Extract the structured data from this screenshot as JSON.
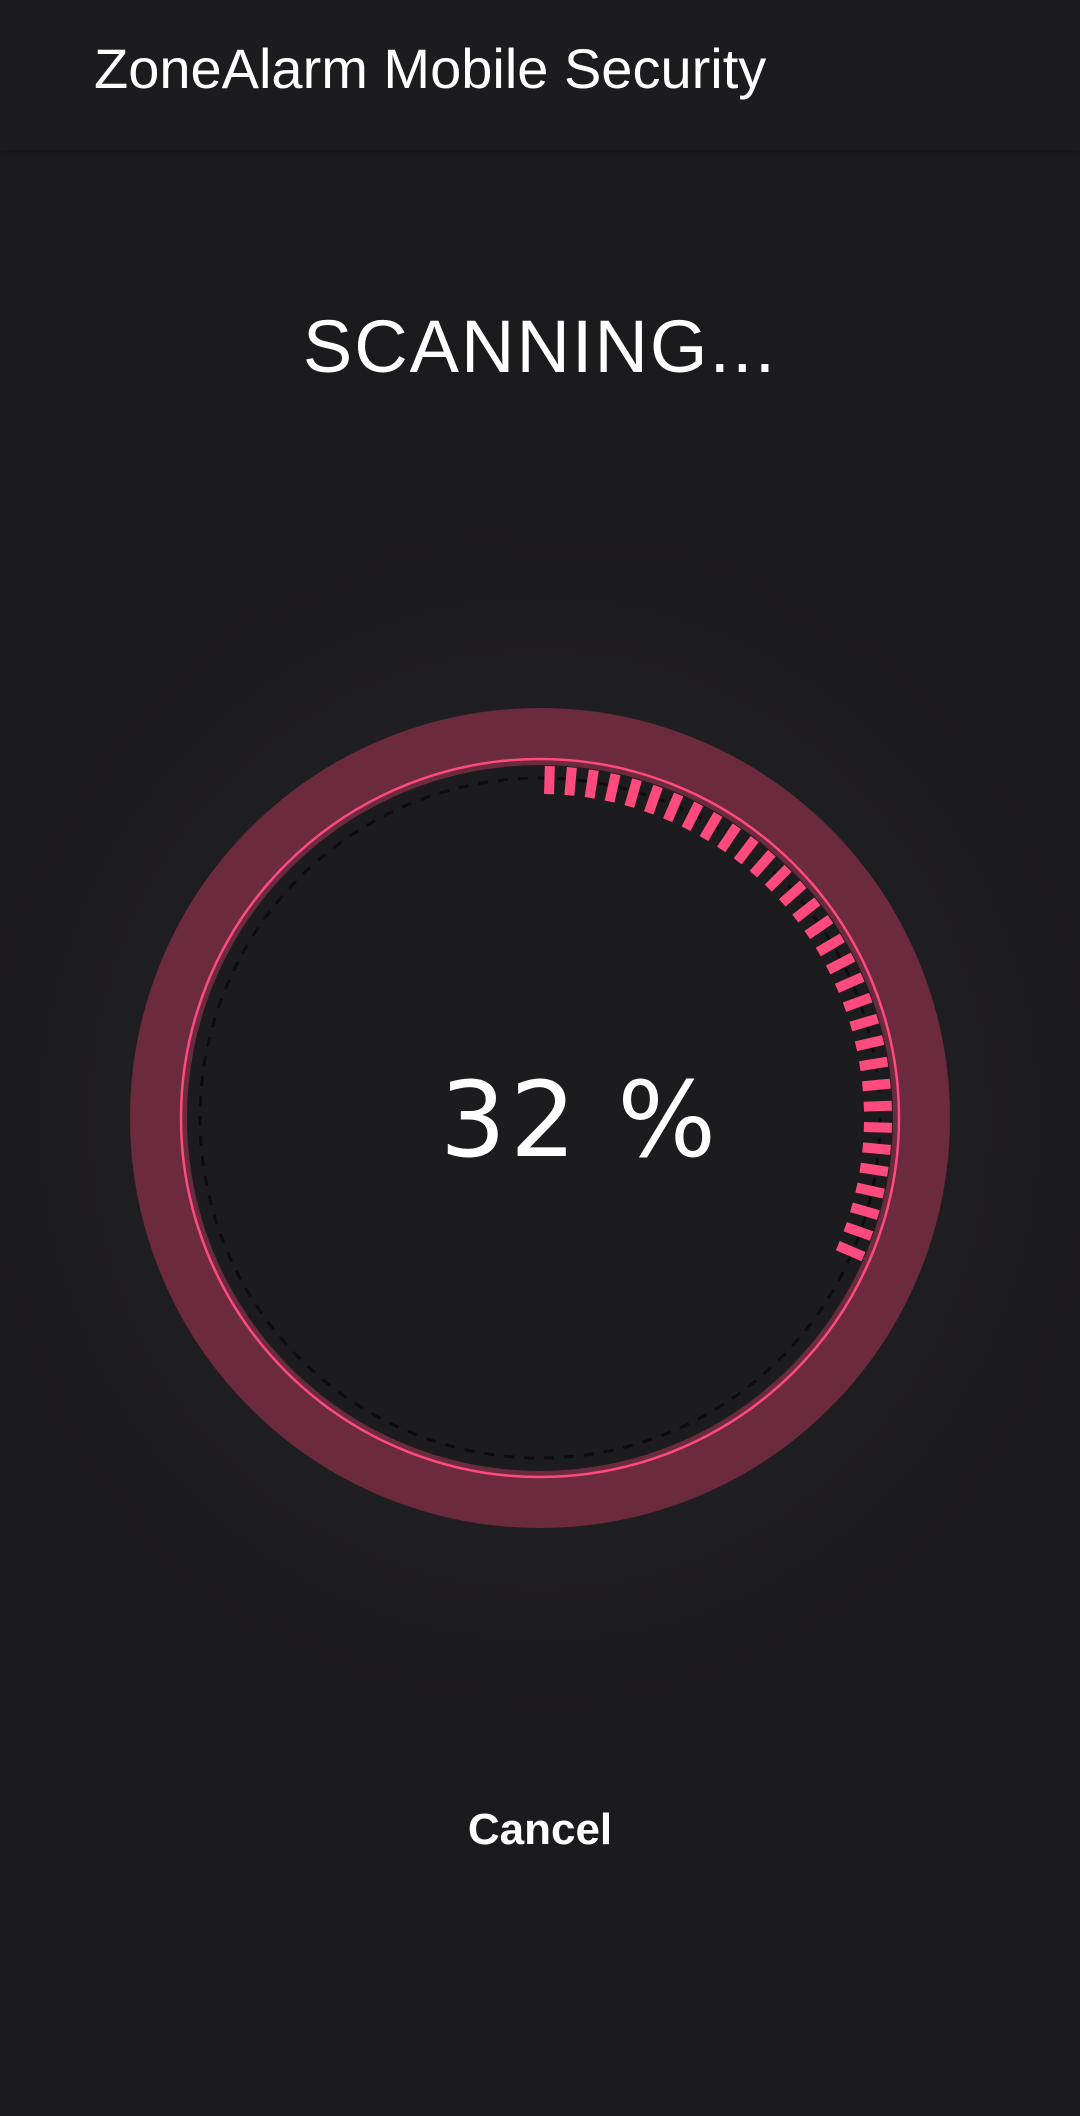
{
  "app_bar": {
    "title": "ZoneAlarm Mobile Security"
  },
  "scan": {
    "status_label": "SCANNING...",
    "progress_label": "32 %",
    "progress": 0.32
  },
  "actions": {
    "cancel_label": "Cancel"
  },
  "colors": {
    "background": "#1b1a1d",
    "ring": "#6b2a3e",
    "accent": "#ff4a7d",
    "inner_fill": "#1c1b1e"
  }
}
